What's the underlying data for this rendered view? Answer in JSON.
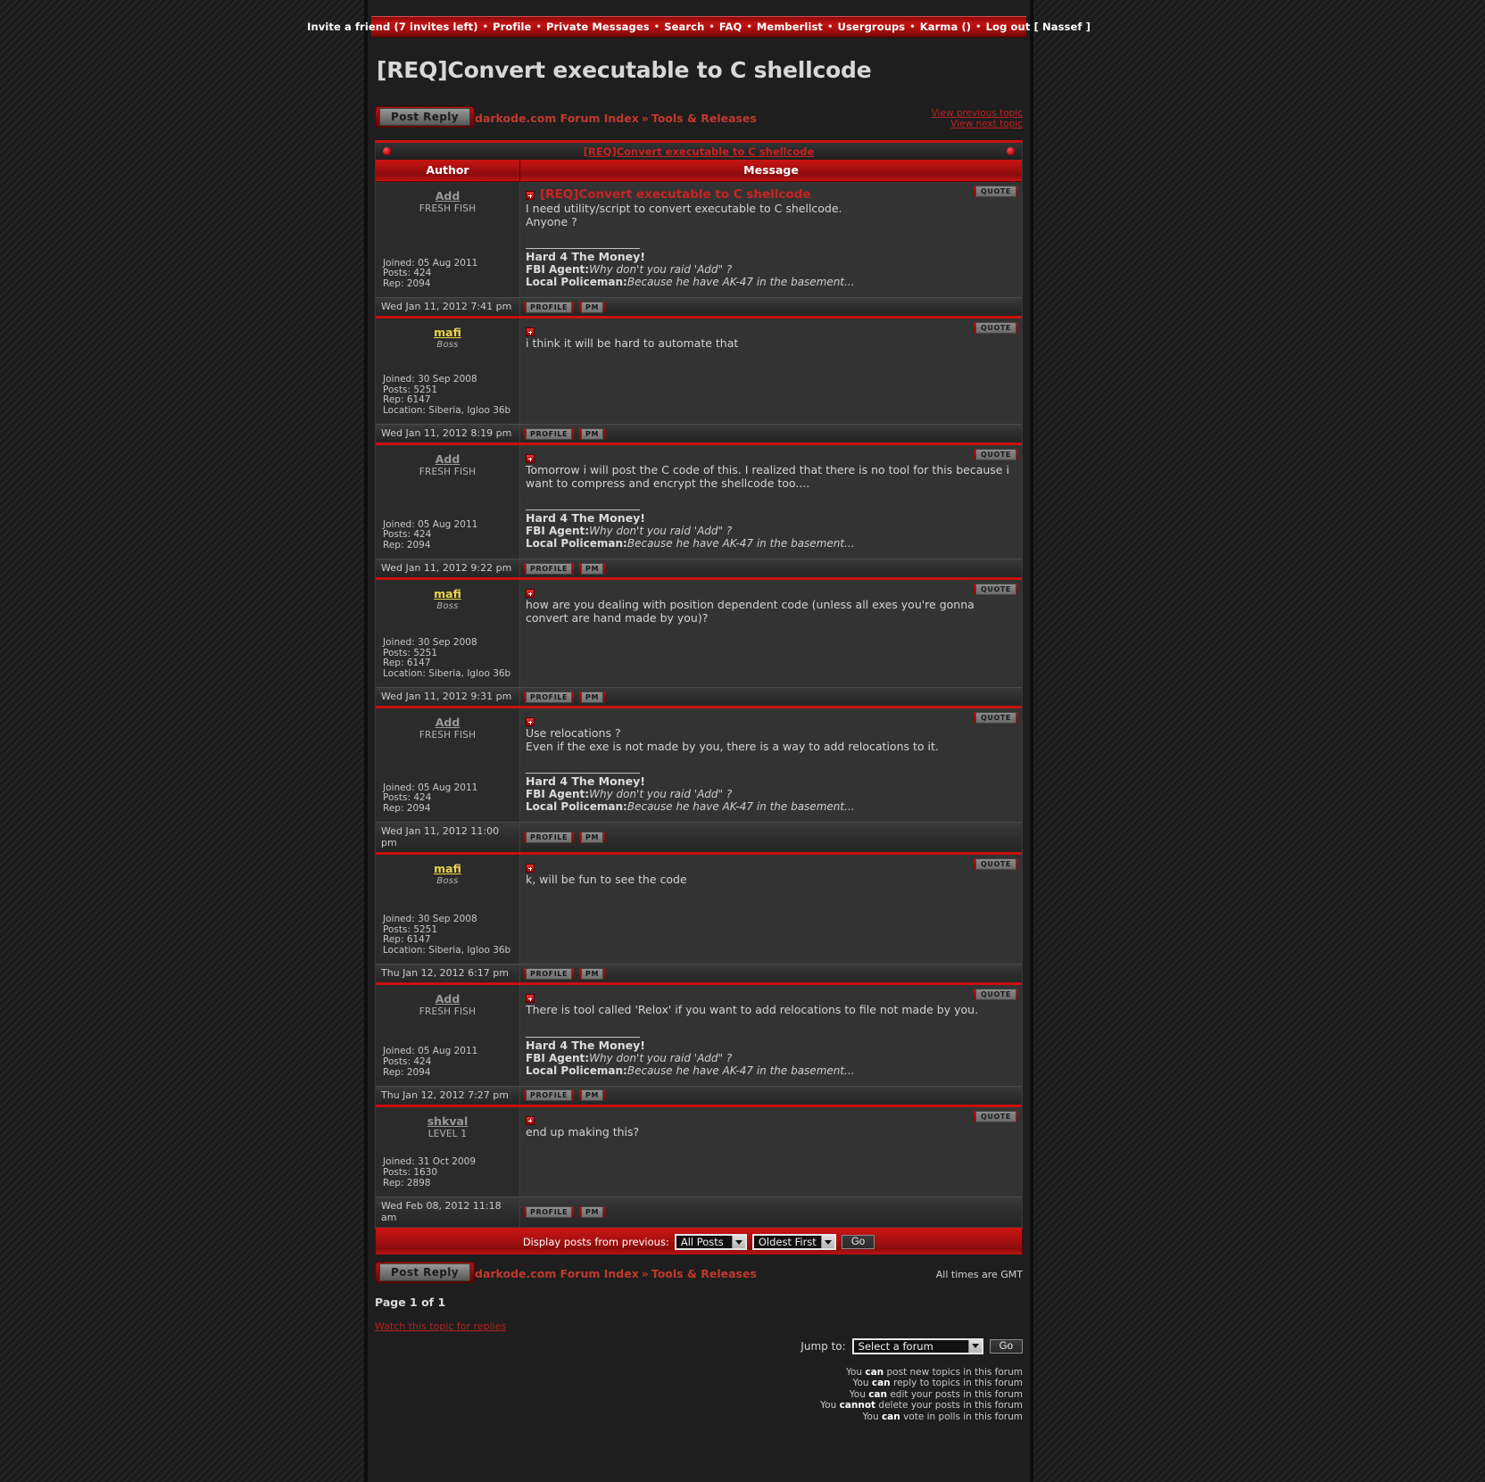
{
  "topnav": {
    "items": [
      {
        "label": "Invite a friend (7 invites left)"
      },
      {
        "label": "Profile"
      },
      {
        "label": "Private Messages"
      },
      {
        "label": "Search"
      },
      {
        "label": "FAQ"
      },
      {
        "label": "Memberlist"
      },
      {
        "label": "Usergroups"
      },
      {
        "label": "Karma ()"
      },
      {
        "label": "Log out [ Nassef ]"
      }
    ],
    "separator": "•"
  },
  "page_title": "[REQ]Convert executable to C shellcode",
  "toolbar": {
    "post_reply_label": "Post Reply",
    "crumb_index": "darkode.com Forum Index",
    "crumb_chevron": "»",
    "crumb_forum": "Tools & Releases",
    "view_previous": "View previous topic",
    "view_next": "View next topic"
  },
  "topic_bar": {
    "title": "[REQ]Convert executable to C shellcode"
  },
  "table_headers": {
    "author": "Author",
    "message": "Message"
  },
  "buttons": {
    "quote": "QUOTE",
    "profile": "PROFILE",
    "pm": "PM"
  },
  "signature": {
    "line1": "Hard 4 The Money!",
    "line2_label": "FBI Agent:",
    "line2_text": "Why don't you raid 'Add\" ?",
    "line3_label": "Local Policeman:",
    "line3_text": "Because he have AK-47 in the basement..."
  },
  "posts": [
    {
      "author": "Add",
      "rank": "FRESH FISH",
      "name_color": "gray",
      "joined": "Joined: 05 Aug 2011",
      "posts": "Posts: 424",
      "rep": "Rep: 2094",
      "location": "",
      "subject": "[REQ]Convert executable to C shellcode",
      "body": "I need utility/script to convert executable to C shellcode.\nAnyone ?",
      "time": "Wed Jan 11, 2012 7:41 pm",
      "has_sig": true
    },
    {
      "author": "mafi",
      "rank": "Boss",
      "name_color": "yellow",
      "joined": "Joined: 30 Sep 2008",
      "posts": "Posts: 5251",
      "rep": "Rep: 6147",
      "location": "Location: Siberia, Igloo 36b",
      "subject": "",
      "body": "i think it will be hard to automate that",
      "time": "Wed Jan 11, 2012 8:19 pm",
      "has_sig": false
    },
    {
      "author": "Add",
      "rank": "FRESH FISH",
      "name_color": "gray",
      "joined": "Joined: 05 Aug 2011",
      "posts": "Posts: 424",
      "rep": "Rep: 2094",
      "location": "",
      "subject": "",
      "body": "Tomorrow i will post the C code of this. I realized that there is no tool for this because i want to compress and encrypt the shellcode too....",
      "time": "Wed Jan 11, 2012 9:22 pm",
      "has_sig": true
    },
    {
      "author": "mafi",
      "rank": "Boss",
      "name_color": "yellow",
      "joined": "Joined: 30 Sep 2008",
      "posts": "Posts: 5251",
      "rep": "Rep: 6147",
      "location": "Location: Siberia, Igloo 36b",
      "subject": "",
      "body": "how are you dealing with position dependent code (unless all exes you're gonna convert are hand made by you)?",
      "time": "Wed Jan 11, 2012 9:31 pm",
      "has_sig": false
    },
    {
      "author": "Add",
      "rank": "FRESH FISH",
      "name_color": "gray",
      "joined": "Joined: 05 Aug 2011",
      "posts": "Posts: 424",
      "rep": "Rep: 2094",
      "location": "",
      "subject": "",
      "body": "Use relocations ?\nEven if the exe is not made by you, there is a way to add relocations to it.",
      "time": "Wed Jan 11, 2012 11:00 pm",
      "has_sig": true
    },
    {
      "author": "mafi",
      "rank": "Boss",
      "name_color": "yellow",
      "joined": "Joined: 30 Sep 2008",
      "posts": "Posts: 5251",
      "rep": "Rep: 6147",
      "location": "Location: Siberia, Igloo 36b",
      "subject": "",
      "body": "k, will be fun to see the code",
      "time": "Thu Jan 12, 2012 6:17 pm",
      "has_sig": false
    },
    {
      "author": "Add",
      "rank": "FRESH FISH",
      "name_color": "gray",
      "joined": "Joined: 05 Aug 2011",
      "posts": "Posts: 424",
      "rep": "Rep: 2094",
      "location": "",
      "subject": "",
      "body": "There is tool called 'Relox' if you want to add relocations to file not made by you.",
      "time": "Thu Jan 12, 2012 7:27 pm",
      "has_sig": true
    },
    {
      "author": "shkval",
      "rank": "LEVEL 1",
      "name_color": "gray",
      "joined": "Joined: 31 Oct 2009",
      "posts": "Posts: 1630",
      "rep": "Rep: 2898",
      "location": "",
      "subject": "",
      "body": "end up making this?",
      "time": "Wed Feb 08, 2012 11:18 am",
      "has_sig": false
    }
  ],
  "display_bar": {
    "label": "Display posts from previous:",
    "posts_filter_value": "All Posts",
    "sort_value": "Oldest First",
    "go_label": "Go"
  },
  "footer": {
    "post_reply_label": "Post Reply",
    "crumb_index": "darkode.com Forum Index",
    "crumb_chevron": "»",
    "crumb_forum": "Tools & Releases",
    "all_times": "All times are GMT",
    "page_of": "Page 1 of 1",
    "watch_link": "Watch this topic for replies",
    "jump_label": "Jump to:",
    "jump_value": "Select a forum",
    "jump_go": "Go",
    "permissions": [
      {
        "pre": "You ",
        "strong": "can",
        "post": " post new topics in this forum"
      },
      {
        "pre": "You ",
        "strong": "can",
        "post": " reply to topics in this forum"
      },
      {
        "pre": "You ",
        "strong": "can",
        "post": " edit your posts in this forum"
      },
      {
        "pre": "You ",
        "strong": "cannot",
        "post": " delete your posts in this forum"
      },
      {
        "pre": "You ",
        "strong": "can",
        "post": " vote in polls in this forum"
      }
    ]
  }
}
